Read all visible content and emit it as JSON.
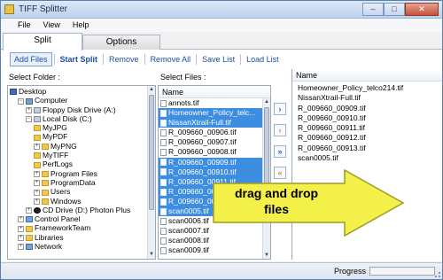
{
  "app": {
    "title": "TIFF Splitter"
  },
  "window_controls": {
    "minimize": "–",
    "maximize": "□",
    "close": "✕"
  },
  "menu": [
    "File",
    "View",
    "Help"
  ],
  "tabs": [
    {
      "label": "Split",
      "active": true
    },
    {
      "label": "Options",
      "active": false
    }
  ],
  "toolbar": {
    "add_files": "Add Files",
    "start_split": "Start Split",
    "remove": "Remove",
    "remove_all": "Remove All",
    "save_list": "Save List",
    "load_list": "Load List"
  },
  "folder_panel": {
    "label": "Select Folder :",
    "tree": [
      {
        "text": "Desktop",
        "icon": "desktop-icon",
        "expander": ""
      },
      {
        "text": "Computer",
        "icon": "computer-icon",
        "expander": "−"
      },
      {
        "text": "Floppy Disk Drive (A:)",
        "icon": "drive-icon",
        "expander": "+"
      },
      {
        "text": "Local Disk (C:)",
        "icon": "drive-icon",
        "expander": "−"
      },
      {
        "text": "MyJPG",
        "icon": "folder-icon",
        "expander": ""
      },
      {
        "text": "MyPDF",
        "icon": "folder-icon",
        "expander": ""
      },
      {
        "text": "MyPNG",
        "icon": "folder-icon",
        "expander": "+"
      },
      {
        "text": "MyTIFF",
        "icon": "folder-icon",
        "expander": ""
      },
      {
        "text": "PerfLogs",
        "icon": "folder-icon",
        "expander": ""
      },
      {
        "text": "Program Files",
        "icon": "folder-icon",
        "expander": "+"
      },
      {
        "text": "ProgramData",
        "icon": "folder-icon",
        "expander": "+"
      },
      {
        "text": "Users",
        "icon": "folder-icon",
        "expander": "+"
      },
      {
        "text": "Windows",
        "icon": "folder-icon",
        "expander": "+"
      },
      {
        "text": "CD Drive (D:) Photon Plus",
        "icon": "cd-icon",
        "expander": "+"
      },
      {
        "text": "Control Panel",
        "icon": "control-panel-icon",
        "expander": "+"
      },
      {
        "text": "FrameworkTeam",
        "icon": "folder-icon",
        "expander": "+"
      },
      {
        "text": "Libraries",
        "icon": "library-icon",
        "expander": "+"
      },
      {
        "text": "Network",
        "icon": "network-icon",
        "expander": "+"
      }
    ]
  },
  "files_panel": {
    "label": "Select Files :",
    "column": "Name",
    "files": [
      {
        "name": "annots.tif",
        "selected": false
      },
      {
        "name": "Homeowner_Policy_telc...",
        "selected": true
      },
      {
        "name": "NissanXtrail-Full.tif",
        "selected": true
      },
      {
        "name": "R_009660_00906.tif",
        "selected": false
      },
      {
        "name": "R_009660_00907.tif",
        "selected": false
      },
      {
        "name": "R_009660_00908.tif",
        "selected": false
      },
      {
        "name": "R_009660_00909.tif",
        "selected": true
      },
      {
        "name": "R_009660_00910.tif",
        "selected": true
      },
      {
        "name": "R_009660_00911.tif",
        "selected": true
      },
      {
        "name": "R_009660_00912.tif",
        "selected": true
      },
      {
        "name": "R_009660_00913.tif",
        "selected": true
      },
      {
        "name": "scan0005.tif",
        "selected": true
      },
      {
        "name": "scan0006.tif",
        "selected": false
      },
      {
        "name": "scan0007.tif",
        "selected": false
      },
      {
        "name": "scan0008.tif",
        "selected": false
      },
      {
        "name": "scan0009.tif",
        "selected": false
      }
    ]
  },
  "move_buttons": {
    "add_one": "›",
    "remove_one": "‹",
    "add_all": "»",
    "remove_all": "«"
  },
  "save_panel": {
    "column": "Name",
    "files": [
      "Homeowner_Policy_telco214.tif",
      "NissanXtrail-Full.tif",
      "R_009660_00909.tif",
      "R_009660_00910.tif",
      "R_009660_00911.tif",
      "R_009660_00912.tif",
      "R_009660_00913.tif",
      "scan0005.tif"
    ]
  },
  "overlay": {
    "line1": "drag and drop",
    "line2": "files",
    "arrow_color": "#f3f04a"
  },
  "status": {
    "progress_label": "Progress",
    "progress": 0.0
  },
  "colors": {
    "accent": "#1d4fa3",
    "selection": "#3d8ee0"
  }
}
